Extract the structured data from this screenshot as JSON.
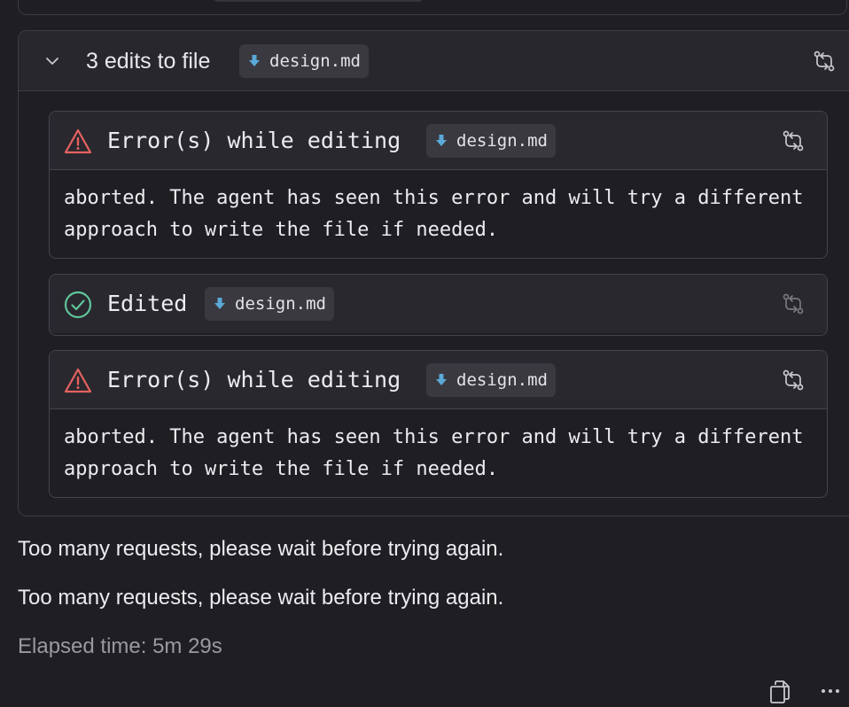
{
  "group": {
    "title": "3 edits to file",
    "file": "design.md"
  },
  "cards": [
    {
      "status": "error",
      "title": "Error(s) while editing",
      "file": "design.md",
      "message": "aborted. The agent has seen this error and will try a different approach to write the file if needed."
    },
    {
      "status": "success",
      "title": "Edited",
      "file": "design.md"
    },
    {
      "status": "error",
      "title": "Error(s) while editing",
      "file": "design.md",
      "message": "aborted. The agent has seen this error and will try a different approach to write the file if needed."
    }
  ],
  "messages": [
    "Too many requests, please wait before trying again.",
    "Too many requests, please wait before trying again."
  ],
  "elapsed": "Elapsed time: 5m 29s",
  "icons": {
    "collapse": "chevron-down-icon",
    "diff": "compare-arrows-icon",
    "error": "warning-triangle-icon",
    "success": "check-circle-icon",
    "file": "markdown-arrow-icon",
    "copy": "copy-icon",
    "more": "more-dots-icon"
  },
  "colors": {
    "error": "#e5625f",
    "success": "#5fc49a",
    "file_icon": "#5aa9d6"
  }
}
